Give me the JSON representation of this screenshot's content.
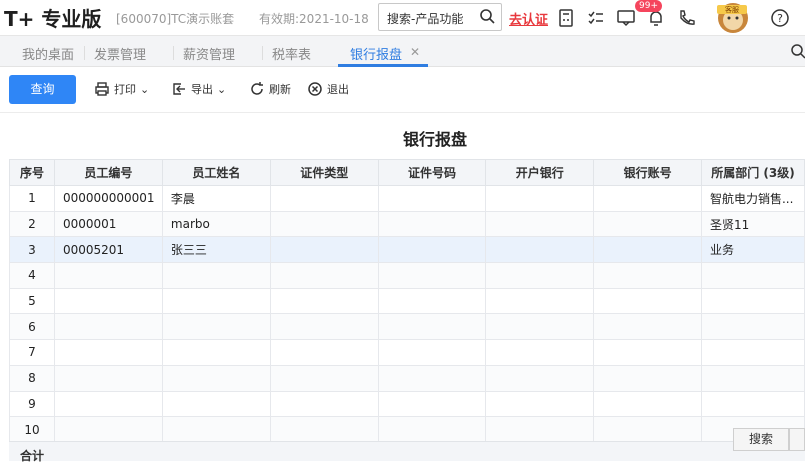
{
  "app": {
    "logo": "T+",
    "edition": "专业版",
    "account": "[600070]TC演示账套",
    "valid_until": "有效期:2021-10-18",
    "search_placeholder": "搜索-产品功能",
    "certify": "去认证",
    "notification_badge": "99+",
    "avatar_label": "客服"
  },
  "tabs": [
    {
      "label": "我的桌面",
      "active": false
    },
    {
      "label": "发票管理",
      "active": false
    },
    {
      "label": "薪资管理",
      "active": false
    },
    {
      "label": "税率表",
      "active": false
    },
    {
      "label": "银行报盘",
      "active": true
    }
  ],
  "toolbar": {
    "query": "查询",
    "print": "打印",
    "export": "导出",
    "refresh": "刷新",
    "exit": "退出"
  },
  "report": {
    "title": "银行报盘",
    "columns": [
      "序号",
      "员工编号",
      "员工姓名",
      "证件类型",
      "证件号码",
      "开户银行",
      "银行账号",
      "所属部门 (3级)"
    ],
    "rows": [
      [
        "1",
        "000000000001",
        "李晨",
        "",
        "",
        "",
        "",
        "智航电力销售..."
      ],
      [
        "2",
        "0000001",
        "marbo",
        "",
        "",
        "",
        "",
        "圣贤11"
      ],
      [
        "3",
        "00005201",
        "张三三",
        "",
        "",
        "",
        "",
        "业务"
      ],
      [
        "4",
        "",
        "",
        "",
        "",
        "",
        "",
        ""
      ],
      [
        "5",
        "",
        "",
        "",
        "",
        "",
        "",
        ""
      ],
      [
        "6",
        "",
        "",
        "",
        "",
        "",
        "",
        ""
      ],
      [
        "7",
        "",
        "",
        "",
        "",
        "",
        "",
        ""
      ],
      [
        "8",
        "",
        "",
        "",
        "",
        "",
        "",
        ""
      ],
      [
        "9",
        "",
        "",
        "",
        "",
        "",
        "",
        ""
      ],
      [
        "10",
        "",
        "",
        "",
        "",
        "",
        "",
        ""
      ]
    ],
    "total_label": "合计",
    "search_button": "搜索"
  },
  "colors": {
    "accent": "#2f86f6",
    "certify": "#e8383d",
    "selected_row": "#eaf2fc"
  }
}
